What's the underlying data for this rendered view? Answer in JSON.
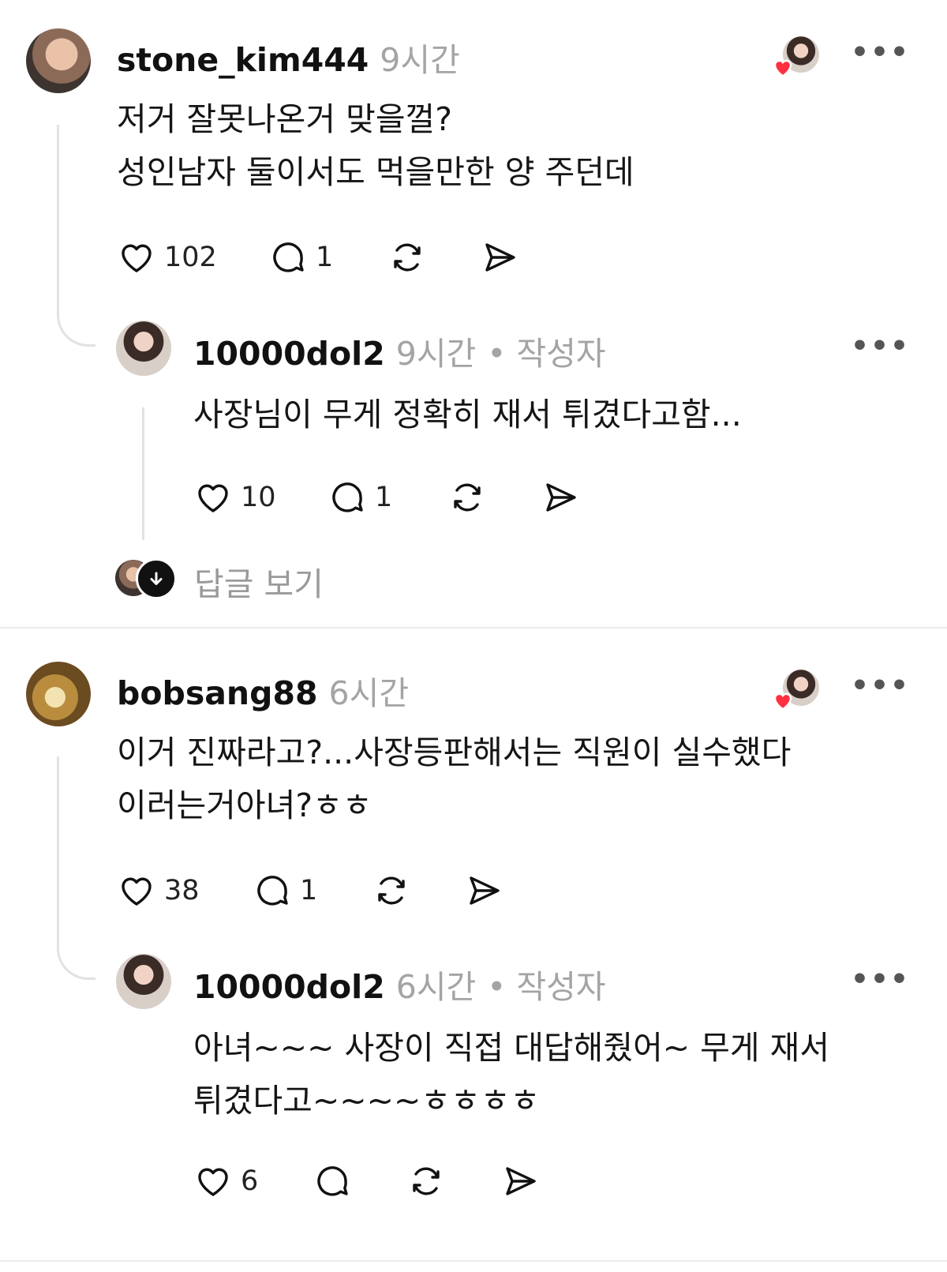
{
  "colors": {
    "accent_heart": "#ff3040",
    "muted": "#a4a4a4",
    "thread": "#e2e2e2"
  },
  "comments": [
    {
      "username": "stone_kim444",
      "time": "9시간",
      "text": "저거 잘못나온거 맞을껄?\n성인남자 둘이서도 먹을만한 양 주던데",
      "likes": "102",
      "replies": "1",
      "reply": {
        "username": "10000dol2",
        "time": "9시간",
        "author_badge": "• 작성자",
        "text": "사장님이 무게 정확히 재서 튀겼다고함...",
        "likes": "10",
        "replies": "1"
      },
      "view_replies": "답글 보기"
    },
    {
      "username": "bobsang88",
      "time": "6시간",
      "text": "이거 진짜라고?...사장등판해서는 직원이 실수했다\n이러는거아녀?ㅎㅎ",
      "likes": "38",
      "replies": "1",
      "reply": {
        "username": "10000dol2",
        "time": "6시간",
        "author_badge": "• 작성자",
        "text": "아녀~~~ 사장이 직접 대답해줬어~ 무게 재서\n튀겼다고~~~~ㅎㅎㅎㅎ",
        "likes": "6"
      }
    }
  ],
  "more_label": "•••",
  "icons": [
    "heart-icon",
    "comment-icon",
    "repost-icon",
    "share-icon",
    "more-icon",
    "down-arrow-icon"
  ]
}
